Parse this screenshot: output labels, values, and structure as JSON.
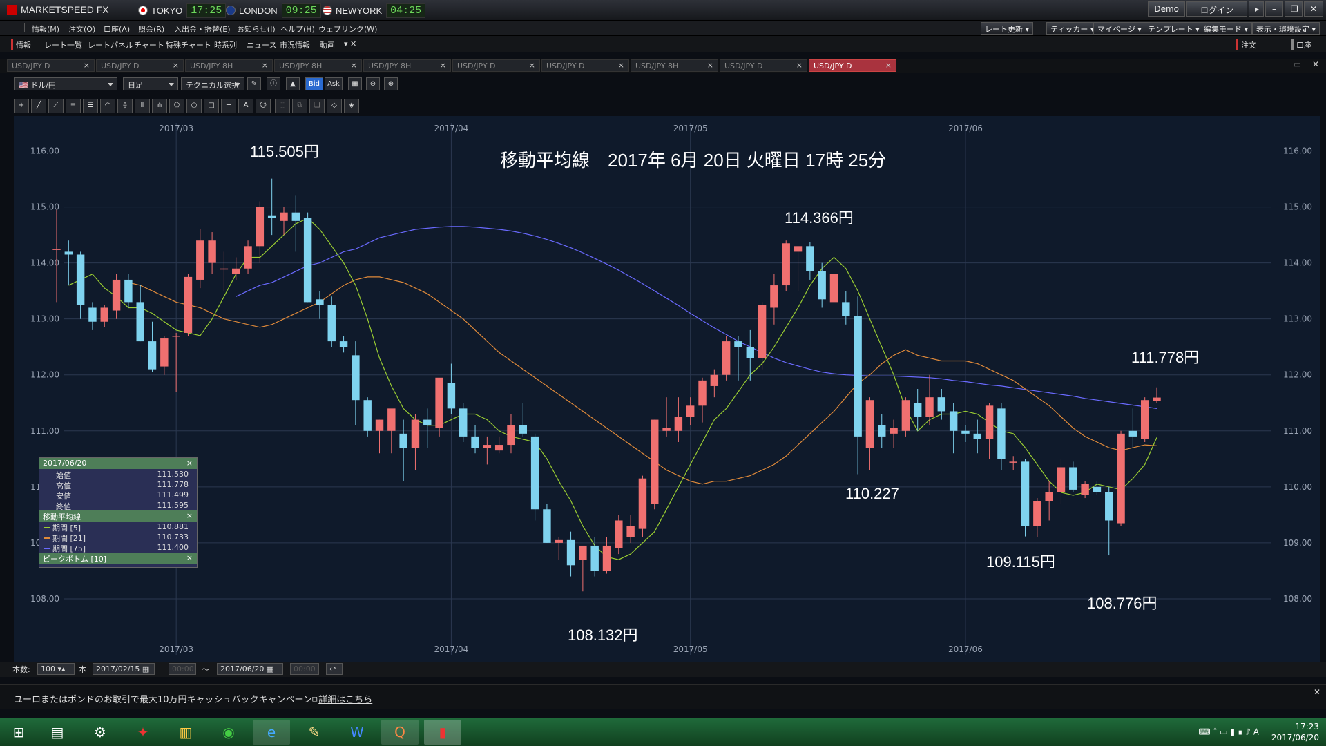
{
  "app": {
    "title": "MARKETSPEED FX",
    "clocks": [
      {
        "city": "TOKYO",
        "time": "17:25"
      },
      {
        "city": "LONDON",
        "time": "09:25"
      },
      {
        "city": "NEWYORK",
        "time": "04:25"
      }
    ],
    "demo": "Demo",
    "login": "ログイン"
  },
  "menu": [
    "情報(M)",
    "注文(O)",
    "口座(A)",
    "照会(R)",
    "入出金・振替(E)",
    "お知らせ(I)",
    "ヘルプ(H)",
    "ウェブリンク(W)"
  ],
  "right_buttons": [
    "レート更新",
    "ティッカー",
    "マイページ",
    "テンプレート",
    "編集モード",
    "表示・環境設定"
  ],
  "submenu": [
    "情報",
    "レート一覧",
    "レートパネル",
    "チャート",
    "特殊チャート",
    "時系列",
    "ニュース",
    "市況情報",
    "動画"
  ],
  "order_btn": "注文",
  "kouza_btn": "口座",
  "tabs": [
    "USD/JPY D",
    "USD/JPY D",
    "USD/JPY 8H",
    "USD/JPY 8H",
    "USD/JPY 8H",
    "USD/JPY D",
    "USD/JPY D",
    "USD/JPY 8H",
    "USD/JPY D",
    "USD/JPY D"
  ],
  "controls": {
    "pair": "ドル/円",
    "period": "日足",
    "technical": "テクニカル選択",
    "bid": "Bid",
    "ask": "Ask"
  },
  "overlays": {
    "title": "移動平均線　2017年 6月 20日 火曜日 17時 25分",
    "high1": "115.505円",
    "high2": "114.366円",
    "high3": "111.778円",
    "low1": "108.132円",
    "low2": "110.227",
    "low3": "109.115円",
    "low4": "108.776円"
  },
  "info": {
    "date": "2017/06/20",
    "rows": [
      [
        "始値",
        "111.530"
      ],
      [
        "高値",
        "111.778"
      ],
      [
        "安値",
        "111.499"
      ],
      [
        "終値",
        "111.595"
      ]
    ],
    "ma_title": "移動平均線",
    "ma_rows": [
      [
        "期間 [5]",
        "110.881"
      ],
      [
        "期間 [21]",
        "110.733"
      ],
      [
        "期間 [75]",
        "111.400"
      ]
    ],
    "pb_title": "ピークボトム [10]"
  },
  "bottom": {
    "count_label": "本数:",
    "count": "100",
    "unit": "本",
    "from": "2017/02/15",
    "tilde": "～",
    "to": "2017/06/20"
  },
  "news": {
    "text": "ユーロまたはポンドのお取引で最大10万円キャッシュバックキャンペーン",
    "link": "詳細はこちら"
  },
  "tray": {
    "time": "17:23",
    "date": "2017/06/20",
    "ime": "A"
  },
  "colors": {
    "up": "#f07070",
    "down": "#7fd3ef",
    "ma5": "#9acd32",
    "ma21": "#e08a3a",
    "ma75": "#6a6aff",
    "bg": "#0f1a2b",
    "grid": "#2b3850"
  },
  "chart_data": {
    "type": "candlestick",
    "ylim": [
      107.0,
      116.5
    ],
    "yticks": [
      "116.00",
      "115.00",
      "114.00",
      "113.00",
      "112.00",
      "111.00",
      "110.00",
      "109.00",
      "108.00"
    ],
    "month_labels": [
      {
        "label": "2017/03",
        "index": 10
      },
      {
        "label": "2017/04",
        "index": 33
      },
      {
        "label": "2017/05",
        "index": 53
      },
      {
        "label": "2017/06",
        "index": 76
      }
    ],
    "candles": [
      [
        114.25,
        114.95,
        113.3,
        114.25
      ],
      [
        114.2,
        114.4,
        113.6,
        114.15
      ],
      [
        114.15,
        114.2,
        113.0,
        113.25
      ],
      [
        113.2,
        113.3,
        112.8,
        112.95
      ],
      [
        112.95,
        113.25,
        112.85,
        113.2
      ],
      [
        113.15,
        113.8,
        113.0,
        113.7
      ],
      [
        113.7,
        113.8,
        113.2,
        113.3
      ],
      [
        113.3,
        113.6,
        112.6,
        112.6
      ],
      [
        112.6,
        112.95,
        112.05,
        112.1
      ],
      [
        112.15,
        112.7,
        112.0,
        112.65
      ],
      [
        112.7,
        112.75,
        111.69,
        112.7
      ],
      [
        112.75,
        113.8,
        112.7,
        113.75
      ],
      [
        113.7,
        114.6,
        113.55,
        114.4
      ],
      [
        114.0,
        114.55,
        113.8,
        114.4
      ],
      [
        113.9,
        114.2,
        113.5,
        113.9
      ],
      [
        113.8,
        114.1,
        113.7,
        113.9
      ],
      [
        113.9,
        114.4,
        113.8,
        114.3
      ],
      [
        114.3,
        115.1,
        114.0,
        115.0
      ],
      [
        114.85,
        115.505,
        114.5,
        114.8
      ],
      [
        114.75,
        115.0,
        114.5,
        114.9
      ],
      [
        114.9,
        115.2,
        114.2,
        114.75
      ],
      [
        114.8,
        114.9,
        113.3,
        113.3
      ],
      [
        113.35,
        113.5,
        113.0,
        113.25
      ],
      [
        113.25,
        113.4,
        112.5,
        112.6
      ],
      [
        112.6,
        112.7,
        112.4,
        112.5
      ],
      [
        112.35,
        112.6,
        111.1,
        111.55
      ],
      [
        111.55,
        111.6,
        110.9,
        111.0
      ],
      [
        111.0,
        111.2,
        110.6,
        111.2
      ],
      [
        111.0,
        111.3,
        110.6,
        111.4
      ],
      [
        110.95,
        111.2,
        110.1,
        110.7
      ],
      [
        110.7,
        111.3,
        110.3,
        111.2
      ],
      [
        111.2,
        111.4,
        110.7,
        111.1
      ],
      [
        111.05,
        111.9,
        110.9,
        111.95
      ],
      [
        111.85,
        112.2,
        111.3,
        111.4
      ],
      [
        111.4,
        111.5,
        110.8,
        110.9
      ],
      [
        110.9,
        111.1,
        110.6,
        110.7
      ],
      [
        110.7,
        110.9,
        110.4,
        110.75
      ],
      [
        110.65,
        110.9,
        110.6,
        110.75
      ],
      [
        110.75,
        111.3,
        110.6,
        111.1
      ],
      [
        111.1,
        111.5,
        110.9,
        110.95
      ],
      [
        110.9,
        110.95,
        109.4,
        109.6
      ],
      [
        109.6,
        109.7,
        109.0,
        109.0
      ],
      [
        109.0,
        109.1,
        108.7,
        109.05
      ],
      [
        109.05,
        109.2,
        108.4,
        108.6
      ],
      [
        108.7,
        108.9,
        108.132,
        108.95
      ],
      [
        108.95,
        109.1,
        108.4,
        108.5
      ],
      [
        108.5,
        109.1,
        108.45,
        108.95
      ],
      [
        108.9,
        109.5,
        108.8,
        109.4
      ],
      [
        109.1,
        109.5,
        109.0,
        109.3
      ],
      [
        109.25,
        110.2,
        109.1,
        110.15
      ],
      [
        109.7,
        111.2,
        109.6,
        111.2
      ],
      [
        111.0,
        111.6,
        110.9,
        111.05
      ],
      [
        111.0,
        111.6,
        110.8,
        111.25
      ],
      [
        111.25,
        111.6,
        111.1,
        111.45
      ],
      [
        111.45,
        111.95,
        111.15,
        111.9
      ],
      [
        111.8,
        112.1,
        111.6,
        112.0
      ],
      [
        112.0,
        112.7,
        111.9,
        112.6
      ],
      [
        112.6,
        112.7,
        111.9,
        112.5
      ],
      [
        112.5,
        112.8,
        111.9,
        112.3
      ],
      [
        112.3,
        113.3,
        112.1,
        113.25
      ],
      [
        113.2,
        113.8,
        112.9,
        113.6
      ],
      [
        113.6,
        114.4,
        113.5,
        114.35
      ],
      [
        114.2,
        114.3,
        113.5,
        114.3
      ],
      [
        114.3,
        114.366,
        113.7,
        113.85
      ],
      [
        113.85,
        114.0,
        113.2,
        113.35
      ],
      [
        113.3,
        113.8,
        113.2,
        113.8
      ],
      [
        113.3,
        113.5,
        112.9,
        113.05
      ],
      [
        113.05,
        113.4,
        110.227,
        110.9
      ],
      [
        110.7,
        111.6,
        110.3,
        111.55
      ],
      [
        111.1,
        111.3,
        110.7,
        110.9
      ],
      [
        110.95,
        111.2,
        110.7,
        111.05
      ],
      [
        111.0,
        111.6,
        110.9,
        111.55
      ],
      [
        111.5,
        111.75,
        111.0,
        111.25
      ],
      [
        111.25,
        112.0,
        111.1,
        111.6
      ],
      [
        111.6,
        111.75,
        111.2,
        111.35
      ],
      [
        111.35,
        111.5,
        110.6,
        111.0
      ],
      [
        111.0,
        111.1,
        110.8,
        110.95
      ],
      [
        110.95,
        111.2,
        110.6,
        110.85
      ],
      [
        110.85,
        111.5,
        110.5,
        111.45
      ],
      [
        111.4,
        111.5,
        110.3,
        110.5
      ],
      [
        110.45,
        110.55,
        110.3,
        110.45
      ],
      [
        110.45,
        110.5,
        109.115,
        109.3
      ],
      [
        109.3,
        109.8,
        109.1,
        109.75
      ],
      [
        109.75,
        110.1,
        109.4,
        109.9
      ],
      [
        109.9,
        110.5,
        109.7,
        110.35
      ],
      [
        110.35,
        110.45,
        109.9,
        109.95
      ],
      [
        109.85,
        110.1,
        109.8,
        110.05
      ],
      [
        110.0,
        110.1,
        109.85,
        109.9
      ],
      [
        109.9,
        110.0,
        108.776,
        109.4
      ],
      [
        109.35,
        111.0,
        109.3,
        110.95
      ],
      [
        111.0,
        111.4,
        110.7,
        110.9
      ],
      [
        110.85,
        111.6,
        110.8,
        111.55
      ],
      [
        111.53,
        111.778,
        111.499,
        111.595
      ]
    ],
    "ma5": [
      113.6,
      113.7,
      113.8,
      113.55,
      113.4,
      113.2,
      113.2,
      113.1,
      112.95,
      112.8,
      112.75,
      112.7,
      113.0,
      113.4,
      113.8,
      114.1,
      114.1,
      114.3,
      114.5,
      114.7,
      114.8,
      114.6,
      114.3,
      114.0,
      113.6,
      113.0,
      112.3,
      111.8,
      111.4,
      111.2,
      111.1,
      111.1,
      111.2,
      111.3,
      111.3,
      111.2,
      111.0,
      110.9,
      110.85,
      110.8,
      110.5,
      110.1,
      109.75,
      109.3,
      108.95,
      108.75,
      108.7,
      108.8,
      109.0,
      109.2,
      109.6,
      110.0,
      110.4,
      110.8,
      111.2,
      111.4,
      111.7,
      112.0,
      112.2,
      112.5,
      112.85,
      113.2,
      113.6,
      113.9,
      114.1,
      113.9,
      113.5,
      113.0,
      112.5,
      112.0,
      111.4,
      111.0,
      111.2,
      111.3,
      111.3,
      111.35,
      111.3,
      111.15,
      111.0,
      110.95,
      110.7,
      110.4,
      110.1,
      109.9,
      109.85,
      109.9,
      110.05,
      110.0,
      109.95,
      110.15,
      110.4,
      110.881
    ],
    "ma21": [
      113.65,
      113.6,
      113.5,
      113.4,
      113.3,
      113.25,
      113.2,
      113.1,
      113.0,
      112.95,
      112.9,
      112.85,
      112.9,
      113.0,
      113.1,
      113.2,
      113.3,
      113.45,
      113.6,
      113.7,
      113.75,
      113.75,
      113.7,
      113.65,
      113.55,
      113.45,
      113.3,
      113.15,
      113.0,
      112.8,
      112.6,
      112.4,
      112.25,
      112.1,
      111.95,
      111.8,
      111.65,
      111.5,
      111.35,
      111.2,
      111.05,
      110.9,
      110.75,
      110.6,
      110.45,
      110.3,
      110.2,
      110.1,
      110.05,
      110.1,
      110.1,
      110.15,
      110.2,
      110.3,
      110.4,
      110.55,
      110.75,
      110.95,
      111.15,
      111.35,
      111.6,
      111.85,
      112.0,
      112.2,
      112.35,
      112.45,
      112.35,
      112.3,
      112.25,
      112.25,
      112.25,
      112.2,
      112.1,
      112.0,
      111.9,
      111.75,
      111.6,
      111.45,
      111.25,
      111.05,
      110.9,
      110.8,
      110.7,
      110.65,
      110.7,
      110.75,
      110.733
    ],
    "ma75": [
      113.4,
      113.5,
      113.6,
      113.65,
      113.75,
      113.85,
      113.95,
      114.0,
      114.1,
      114.2,
      114.25,
      114.35,
      114.45,
      114.5,
      114.55,
      114.6,
      114.62,
      114.64,
      114.65,
      114.65,
      114.64,
      114.62,
      114.6,
      114.57,
      114.53,
      114.48,
      114.42,
      114.35,
      114.27,
      114.18,
      114.08,
      113.98,
      113.87,
      113.75,
      113.63,
      113.5,
      113.37,
      113.24,
      113.1,
      112.97,
      112.84,
      112.72,
      112.6,
      112.5,
      112.4,
      112.3,
      112.22,
      112.16,
      112.1,
      112.05,
      112.02,
      112.0,
      111.99,
      111.98,
      111.98,
      111.98,
      111.97,
      111.96,
      111.95,
      111.93,
      111.9,
      111.88,
      111.85,
      111.82,
      111.8,
      111.77,
      111.74,
      111.71,
      111.68,
      111.65,
      111.62,
      111.58,
      111.55,
      111.52,
      111.49,
      111.46,
      111.43,
      111.4
    ]
  }
}
